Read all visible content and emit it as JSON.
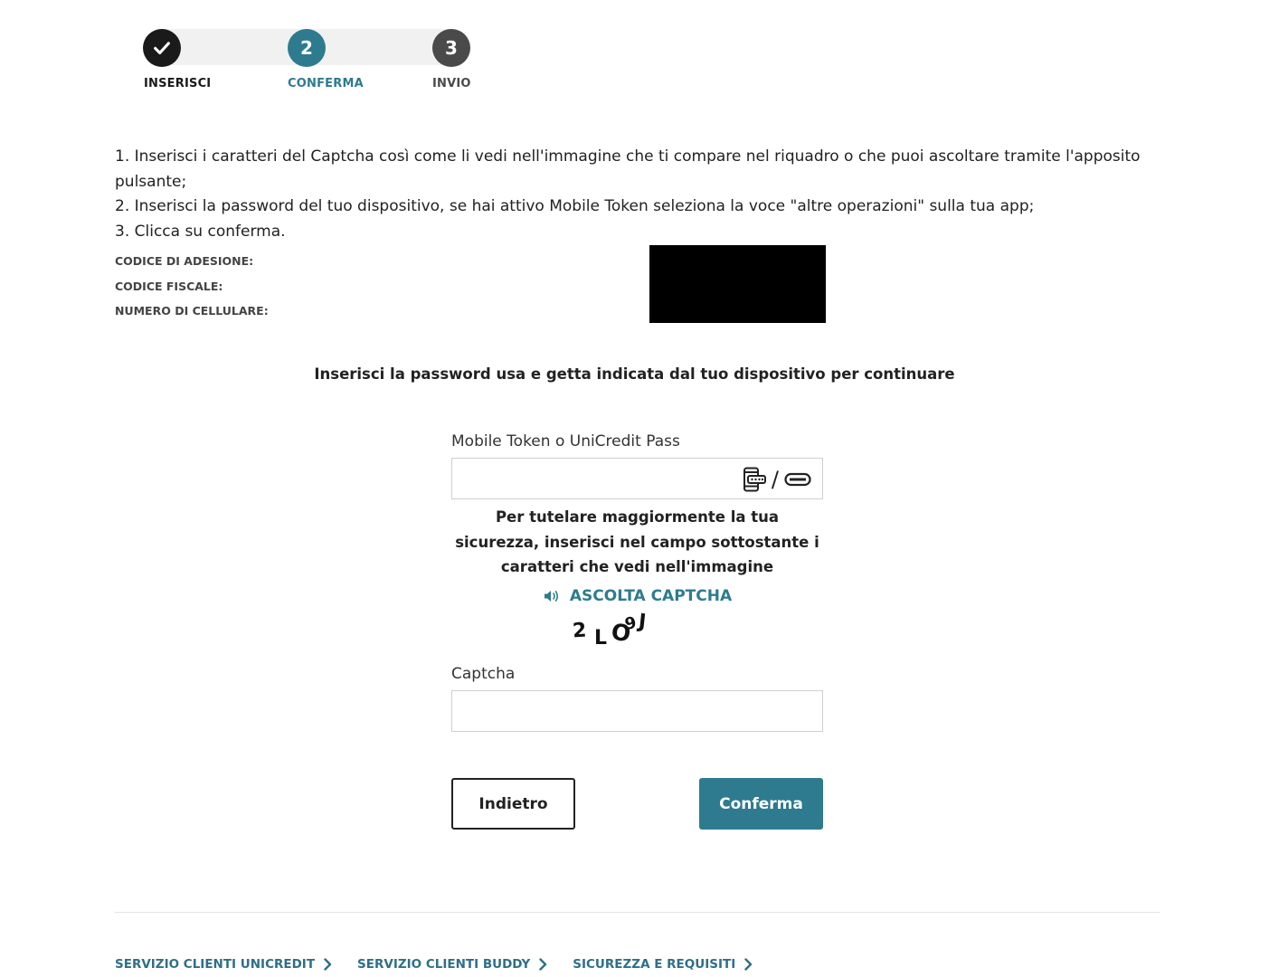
{
  "stepper": {
    "steps": [
      {
        "number": "",
        "label": "INSERISCI",
        "status": "completed"
      },
      {
        "number": "2",
        "label": "CONFERMA",
        "status": "active"
      },
      {
        "number": "3",
        "label": "INVIO",
        "status": "pending"
      }
    ]
  },
  "instructions": [
    "1. Inserisci i caratteri del Captcha così come li vedi nell'immagine che ti compare nel riquadro o che puoi ascoltare tramite l'apposito pulsante;",
    "2. Inserisci la password del tuo dispositivo, se hai attivo Mobile Token seleziona la voce \"altre operazioni\" sulla tua app;",
    "3. Clicca su conferma."
  ],
  "info": {
    "codice_adesione_label": "CODICE DI ADESIONE:",
    "codice_fiscale_label": "CODICE FISCALE:",
    "numero_cellulare_label": "NUMERO DI CELLULARE:"
  },
  "prompt": "Inserisci la password usa e getta indicata dal tuo dispositivo per continuare",
  "token_field": {
    "label": "Mobile Token o UniCredit Pass",
    "value": "",
    "slash": "/"
  },
  "security_text": "Per tutelare maggiormente la tua sicurezza, inserisci nel campo sottostante i caratteri che vedi nell'immagine",
  "audio_captcha_label": "ASCOLTA CAPTCHA",
  "captcha_chars": [
    "2",
    "L",
    "O",
    "9",
    "J"
  ],
  "captcha_field": {
    "label": "Captcha",
    "value": ""
  },
  "buttons": {
    "back_label": "Indietro",
    "confirm_label": "Conferma"
  },
  "footer": {
    "links": [
      "SERVIZIO CLIENTI UNICREDIT",
      "SERVIZIO CLIENTI BUDDY",
      "SICUREZZA E REQUISITI"
    ]
  },
  "colors": {
    "accent": "#2e7b8f",
    "dark": "#1a1a1a",
    "pending": "#4a4a4a"
  }
}
